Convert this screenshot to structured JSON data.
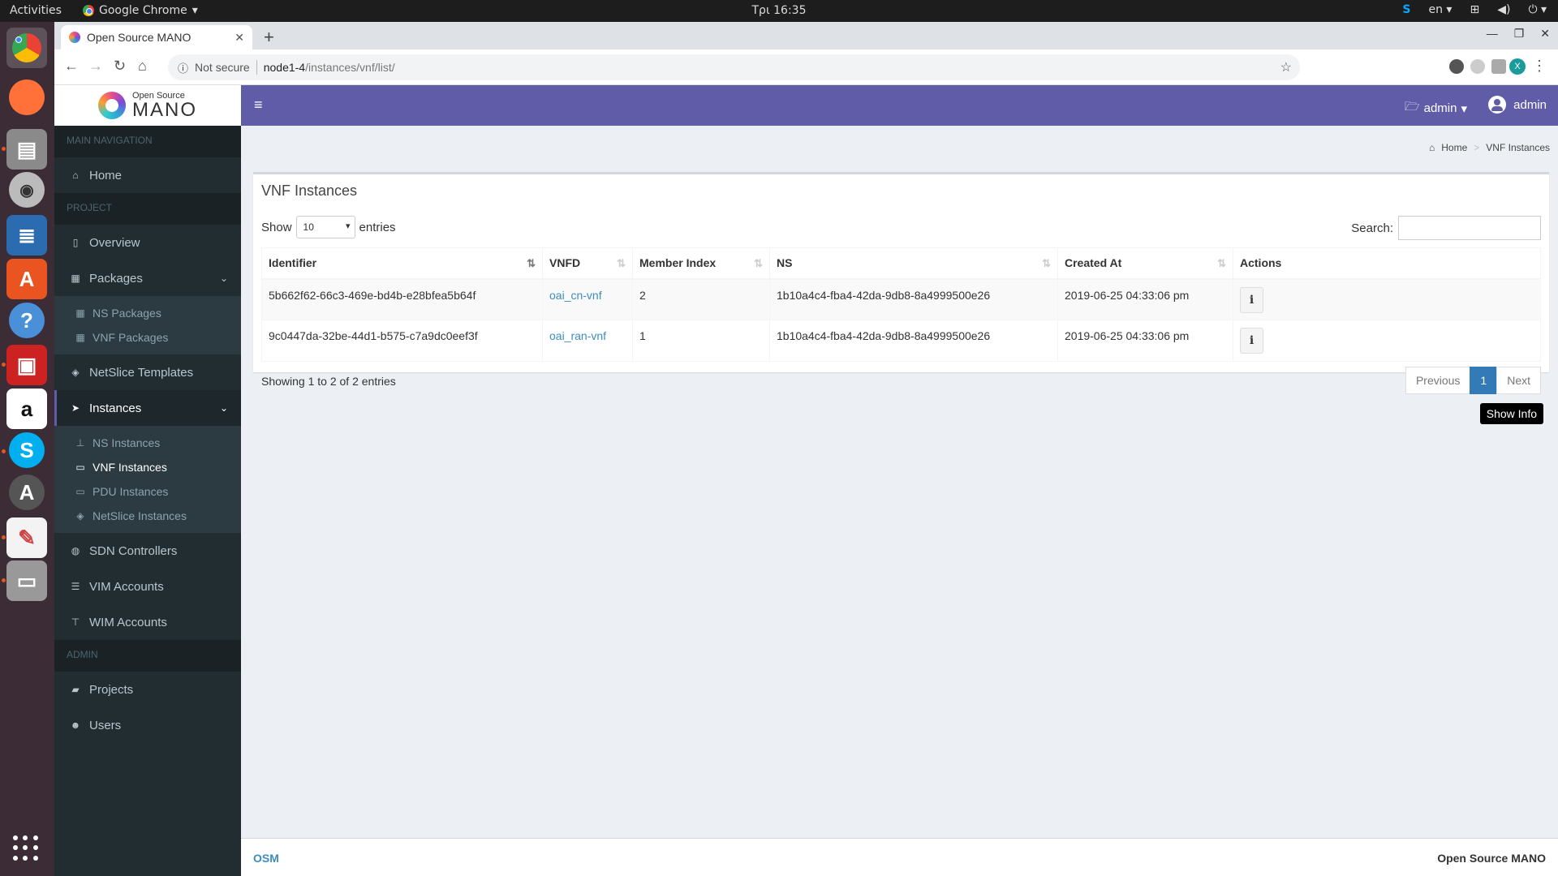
{
  "desktop": {
    "activities": "Activities",
    "app_menu": "Google Chrome",
    "clock": "Τρι 16:35",
    "lang": "en",
    "dock_apps": [
      "chrome-icon",
      "firefox-icon",
      "files-icon",
      "rhythmbox-icon",
      "writer-icon",
      "software-icon",
      "help-icon",
      "terminal-icon",
      "amazon-icon",
      "skype-icon",
      "updater-icon",
      "editor-icon",
      "scanner-icon",
      "app-grid-icon"
    ]
  },
  "browser": {
    "tab_title": "Open Source MANO",
    "security": "Not secure",
    "url_host": "node1-4",
    "url_path": "/instances/vnf/list/",
    "profile_initial": "X"
  },
  "app": {
    "logo_small": "Open Source",
    "logo_big": "MANO",
    "project_menu": "admin",
    "user_menu": "admin"
  },
  "sidebar": {
    "main_header": "MAIN NAVIGATION",
    "home": "Home",
    "project_header": "PROJECT",
    "overview": "Overview",
    "packages": "Packages",
    "ns_packages": "NS Packages",
    "vnf_packages": "VNF Packages",
    "netslice_templates": "NetSlice Templates",
    "instances": "Instances",
    "ns_instances": "NS Instances",
    "vnf_instances": "VNF Instances",
    "pdu_instances": "PDU Instances",
    "netslice_instances": "NetSlice Instances",
    "sdn_controllers": "SDN Controllers",
    "vim_accounts": "VIM Accounts",
    "wim_accounts": "WIM Accounts",
    "admin_header": "ADMIN",
    "projects": "Projects",
    "users": "Users"
  },
  "breadcrumb": {
    "home": "Home",
    "current": "VNF Instances"
  },
  "box": {
    "title": "VNF Instances",
    "show": "Show",
    "page_length": "10",
    "entries": "entries",
    "search_label": "Search:",
    "search_value": ""
  },
  "table": {
    "columns": [
      "Identifier",
      "VNFD",
      "Member Index",
      "NS",
      "Created At",
      "Actions"
    ],
    "rows": [
      {
        "identifier": "5b662f62-66c3-469e-bd4b-e28bfea5b64f",
        "vnfd": "oai_cn-vnf",
        "member_index": "2",
        "ns": "1b10a4c4-fba4-42da-9db8-8a4999500e26",
        "created_at": "2019-06-25 04:33:06 pm"
      },
      {
        "identifier": "9c0447da-32be-44d1-b575-c7a9dc0eef3f",
        "vnfd": "oai_ran-vnf",
        "member_index": "1",
        "ns": "1b10a4c4-fba4-42da-9db8-8a4999500e26",
        "created_at": "2019-06-25 04:33:06 pm"
      }
    ],
    "info_glyph": "i",
    "showing": "Showing 1 to 2 of 2 entries"
  },
  "pager": {
    "previous": "Previous",
    "current": "1",
    "next": "Next"
  },
  "tooltip": "Show Info",
  "footer": {
    "left": "OSM",
    "right": "Open Source MANO"
  },
  "colors": {
    "header": "#605ca8",
    "sidebar": "#222d32",
    "link": "#3c8dbc",
    "pager_active": "#337ab7"
  }
}
